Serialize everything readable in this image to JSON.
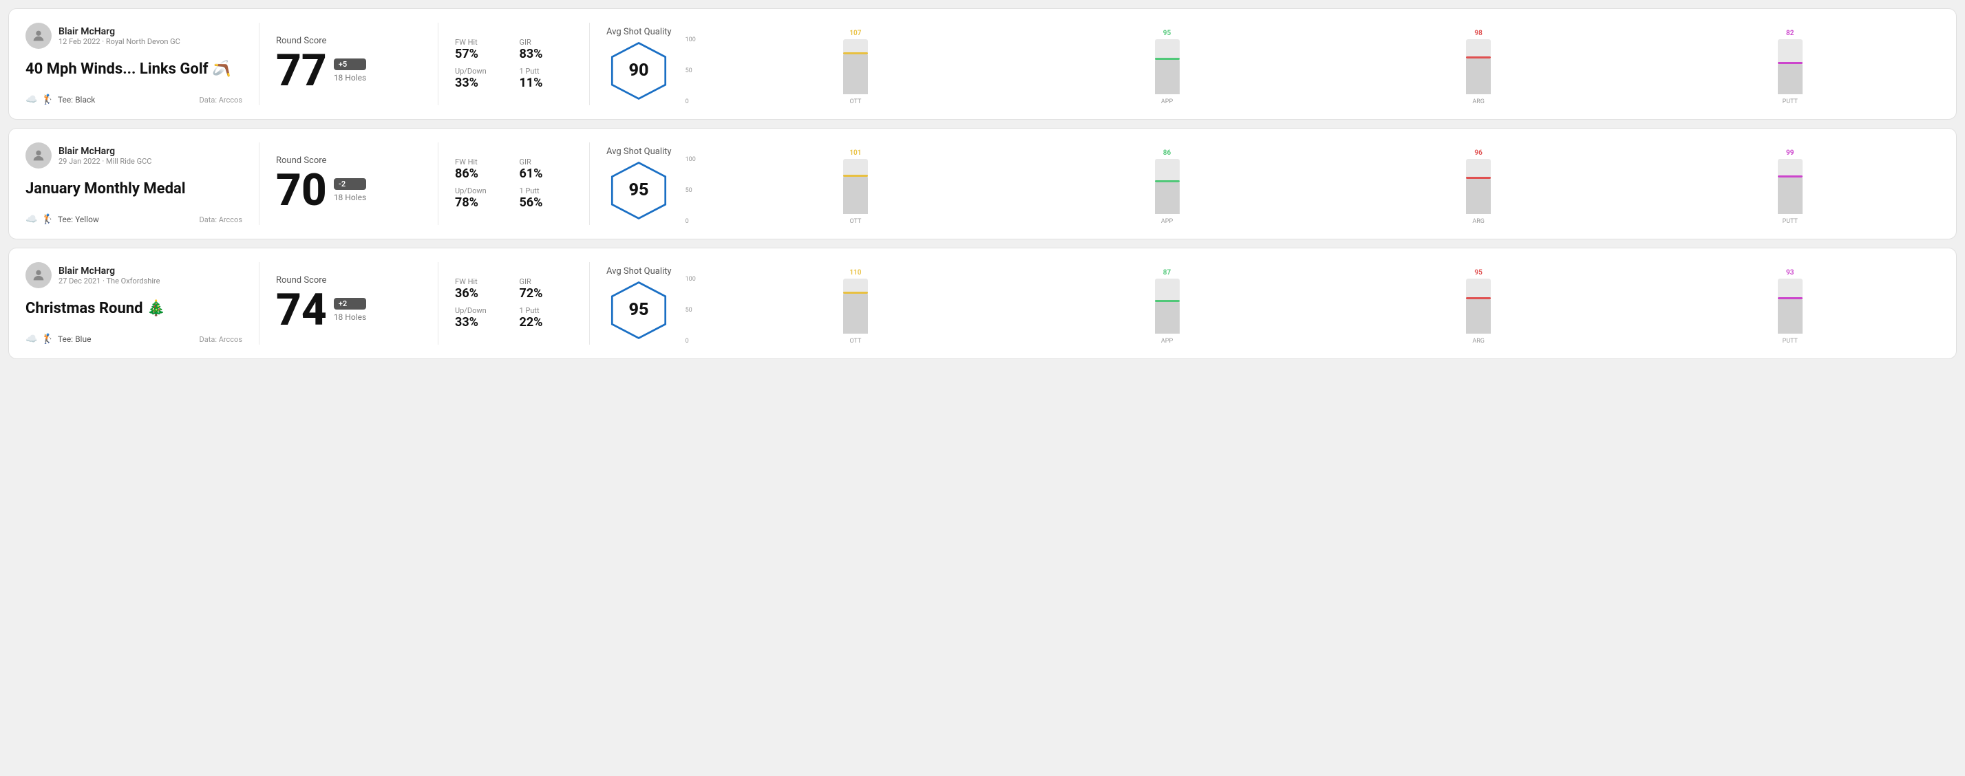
{
  "rounds": [
    {
      "id": "round1",
      "user": {
        "name": "Blair McHarg",
        "date_course": "12 Feb 2022 · Royal North Devon GC"
      },
      "title": "40 Mph Winds... Links Golf 🪃",
      "tee": "Tee: Black",
      "data_source": "Data: Arccos",
      "round_score_label": "Round Score",
      "score": "77",
      "score_badge": "+5",
      "holes": "18 Holes",
      "stats": {
        "fw_hit_label": "FW Hit",
        "fw_hit_value": "57%",
        "gir_label": "GIR",
        "gir_value": "83%",
        "updown_label": "Up/Down",
        "updown_value": "33%",
        "oneputt_label": "1 Putt",
        "oneputt_value": "11%"
      },
      "quality": {
        "label": "Avg Shot Quality",
        "score": "90"
      },
      "chart": {
        "bars": [
          {
            "label": "OTT",
            "top_value": "107",
            "height_pct": 72,
            "color": "#e8c040"
          },
          {
            "label": "APP",
            "top_value": "95",
            "height_pct": 63,
            "color": "#50c878"
          },
          {
            "label": "ARG",
            "top_value": "98",
            "height_pct": 65,
            "color": "#e05050"
          },
          {
            "label": "PUTT",
            "top_value": "82",
            "height_pct": 55,
            "color": "#cc44cc"
          }
        ],
        "y_labels": [
          "100",
          "50",
          "0"
        ]
      }
    },
    {
      "id": "round2",
      "user": {
        "name": "Blair McHarg",
        "date_course": "29 Jan 2022 · Mill Ride GCC"
      },
      "title": "January Monthly Medal",
      "tee": "Tee: Yellow",
      "data_source": "Data: Arccos",
      "round_score_label": "Round Score",
      "score": "70",
      "score_badge": "-2",
      "holes": "18 Holes",
      "stats": {
        "fw_hit_label": "FW Hit",
        "fw_hit_value": "86%",
        "gir_label": "GIR",
        "gir_value": "61%",
        "updown_label": "Up/Down",
        "updown_value": "78%",
        "oneputt_label": "1 Putt",
        "oneputt_value": "56%"
      },
      "quality": {
        "label": "Avg Shot Quality",
        "score": "95"
      },
      "chart": {
        "bars": [
          {
            "label": "OTT",
            "top_value": "101",
            "height_pct": 68,
            "color": "#e8c040"
          },
          {
            "label": "APP",
            "top_value": "86",
            "height_pct": 57,
            "color": "#50c878"
          },
          {
            "label": "ARG",
            "top_value": "96",
            "height_pct": 64,
            "color": "#e05050"
          },
          {
            "label": "PUTT",
            "top_value": "99",
            "height_pct": 66,
            "color": "#cc44cc"
          }
        ],
        "y_labels": [
          "100",
          "50",
          "0"
        ]
      }
    },
    {
      "id": "round3",
      "user": {
        "name": "Blair McHarg",
        "date_course": "27 Dec 2021 · The Oxfordshire"
      },
      "title": "Christmas Round 🎄",
      "tee": "Tee: Blue",
      "data_source": "Data: Arccos",
      "round_score_label": "Round Score",
      "score": "74",
      "score_badge": "+2",
      "holes": "18 Holes",
      "stats": {
        "fw_hit_label": "FW Hit",
        "fw_hit_value": "36%",
        "gir_label": "GIR",
        "gir_value": "72%",
        "updown_label": "Up/Down",
        "updown_value": "33%",
        "oneputt_label": "1 Putt",
        "oneputt_value": "22%"
      },
      "quality": {
        "label": "Avg Shot Quality",
        "score": "95"
      },
      "chart": {
        "bars": [
          {
            "label": "OTT",
            "top_value": "110",
            "height_pct": 73,
            "color": "#e8c040"
          },
          {
            "label": "APP",
            "top_value": "87",
            "height_pct": 58,
            "color": "#50c878"
          },
          {
            "label": "ARG",
            "top_value": "95",
            "height_pct": 63,
            "color": "#e05050"
          },
          {
            "label": "PUTT",
            "top_value": "93",
            "height_pct": 62,
            "color": "#cc44cc"
          }
        ],
        "y_labels": [
          "100",
          "50",
          "0"
        ]
      }
    }
  ]
}
